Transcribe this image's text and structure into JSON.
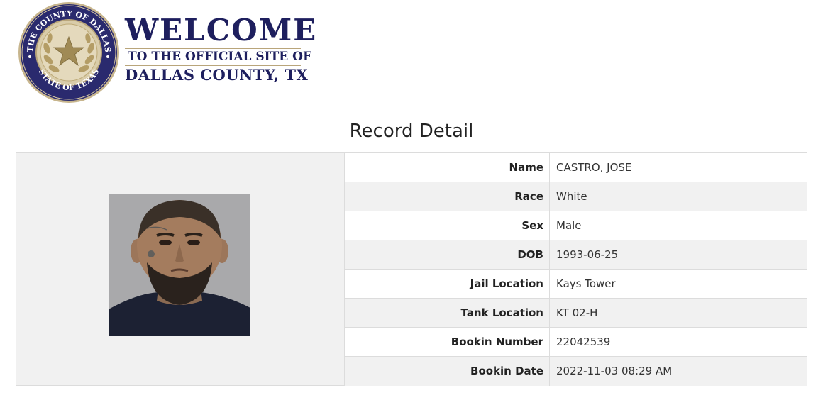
{
  "header": {
    "welcome": "WELCOME",
    "subtitle": "TO THE OFFICIAL SITE OF",
    "county": "DALLAS COUNTY, TX",
    "seal_top_text": "THE COUNTY OF DALLAS",
    "seal_bottom_text": "STATE OF TEXAS"
  },
  "page_title": "Record Detail",
  "record": {
    "rows": [
      {
        "label": "Name",
        "value": "CASTRO, JOSE"
      },
      {
        "label": "Race",
        "value": "White"
      },
      {
        "label": "Sex",
        "value": "Male"
      },
      {
        "label": "DOB",
        "value": "1993-06-25"
      },
      {
        "label": "Jail Location",
        "value": "Kays Tower"
      },
      {
        "label": "Tank Location",
        "value": "KT 02-H"
      },
      {
        "label": "Bookin Number",
        "value": "22042539"
      },
      {
        "label": "Bookin Date",
        "value": "2022-11-03 08:29 AM"
      }
    ]
  },
  "colors": {
    "navy": "#1e1f5e",
    "gold": "#b9a57a",
    "row_alt": "#f1f1f1",
    "border": "#dcdcdc"
  }
}
